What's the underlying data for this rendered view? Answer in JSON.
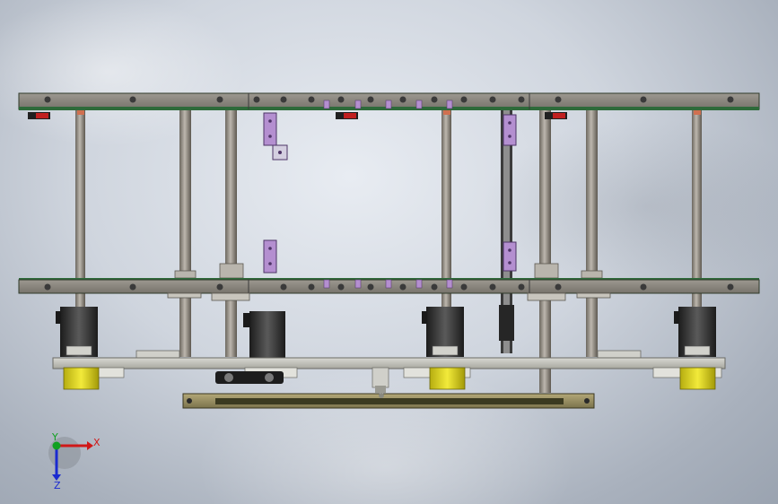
{
  "colors": {
    "plate": "#8d8a82",
    "plate_edge": "#2f3a2a",
    "green_trim": "#2e6a3a",
    "rod": "#9a948c",
    "slot_bracket": "#b48fd0",
    "motor_yellow": "#e8df1e",
    "motor_black": "#2a2a2a",
    "sensor_red": "#c02020",
    "axis_x": "#d01818",
    "axis_y": "#10a020",
    "axis_z": "#1a2ad0"
  },
  "triad": {
    "x_label": "X",
    "y_label": "Y",
    "z_label": "Z",
    "x_icon": "x-axis-arrow-icon",
    "y_icon": "y-axis-arrow-icon",
    "z_icon": "z-axis-arrow-icon"
  }
}
